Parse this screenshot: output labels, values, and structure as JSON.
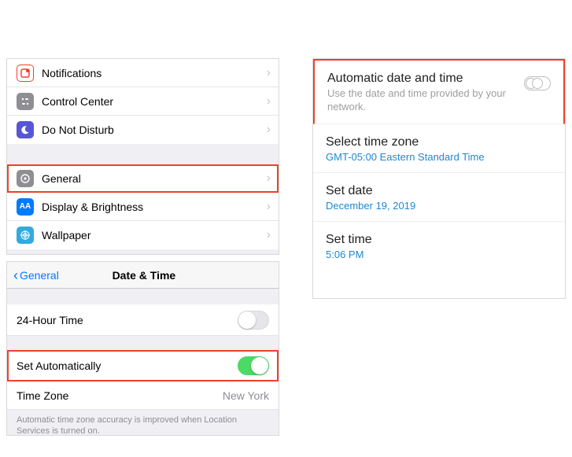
{
  "ios_settings": {
    "group1": [
      {
        "label": "Notifications"
      },
      {
        "label": "Control Center"
      },
      {
        "label": "Do Not Disturb"
      }
    ],
    "group2": [
      {
        "label": "General",
        "highlight": true
      },
      {
        "label": "Display & Brightness"
      },
      {
        "label": "Wallpaper"
      }
    ]
  },
  "ios_datetime": {
    "back": "General",
    "title": "Date & Time",
    "row_24h": "24-Hour Time",
    "row_auto": "Set Automatically",
    "row_tz_label": "Time Zone",
    "row_tz_value": "New York",
    "footnote": "Automatic time zone accuracy is improved when Location Services is turned on."
  },
  "android": {
    "auto": {
      "title": "Automatic date and time",
      "sub": "Use the date and time provided by your network."
    },
    "tz": {
      "title": "Select time zone",
      "value": "GMT-05:00 Eastern Standard Time"
    },
    "date": {
      "title": "Set date",
      "value": "December 19, 2019"
    },
    "time": {
      "title": "Set time",
      "value": "5:06 PM"
    }
  }
}
